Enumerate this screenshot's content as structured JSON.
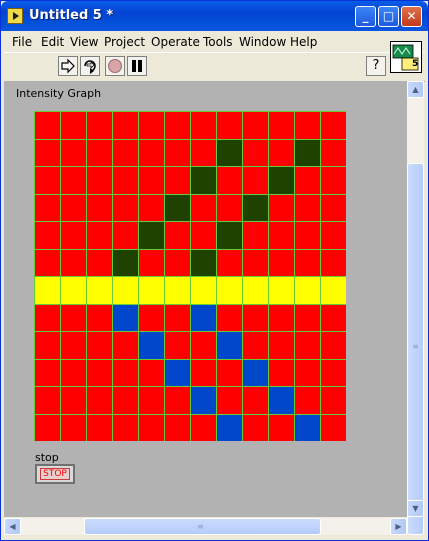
{
  "window": {
    "title": "Untitled 5 *",
    "minimize_glyph": "_",
    "maximize_glyph": "□",
    "close_glyph": "✕"
  },
  "menu": [
    {
      "label": "File"
    },
    {
      "label": "Edit"
    },
    {
      "label": "View"
    },
    {
      "label": "Project"
    },
    {
      "label": "Operate"
    },
    {
      "label": "Tools"
    },
    {
      "label": "Window"
    },
    {
      "label": "Help"
    }
  ],
  "toolbar": {
    "run_icon": "run-arrow-icon",
    "run_continuous_icon": "run-continuously-icon",
    "abort_icon": "abort-execution-icon",
    "pause_icon": "pause-icon",
    "help_label": "?",
    "vi_icon_number": "5"
  },
  "panel": {
    "graph_label": "Intensity Graph",
    "stop_label": "stop",
    "stop_button_text": "STOP"
  },
  "intensity": {
    "rows": 12,
    "cols": 12,
    "colors": {
      "red": "#ff0000",
      "green": "#1f4200",
      "yellow": "#ffff00",
      "blue": "#0047cc",
      "grid": "#66cc33"
    },
    "grid": [
      "RRRRRRRRRRRR",
      "RRRRRRRGRRGR",
      "RRRRRRGRRGRR",
      "RRRRRGRRGRRR",
      "RRRRGRRGRRRR",
      "RRRGRRGRRRRR",
      "YYYYYYYYYYYY",
      "RRRBRRBRRRRR",
      "RRRRBRRBRRRR",
      "RRRRRBRRBRRR",
      "RRRRRRBRRBRR",
      "RRRRRRRBRRBR"
    ]
  },
  "scroll": {
    "up": "▲",
    "down": "▼",
    "left": "◀",
    "right": "▶",
    "grip": "≡"
  }
}
